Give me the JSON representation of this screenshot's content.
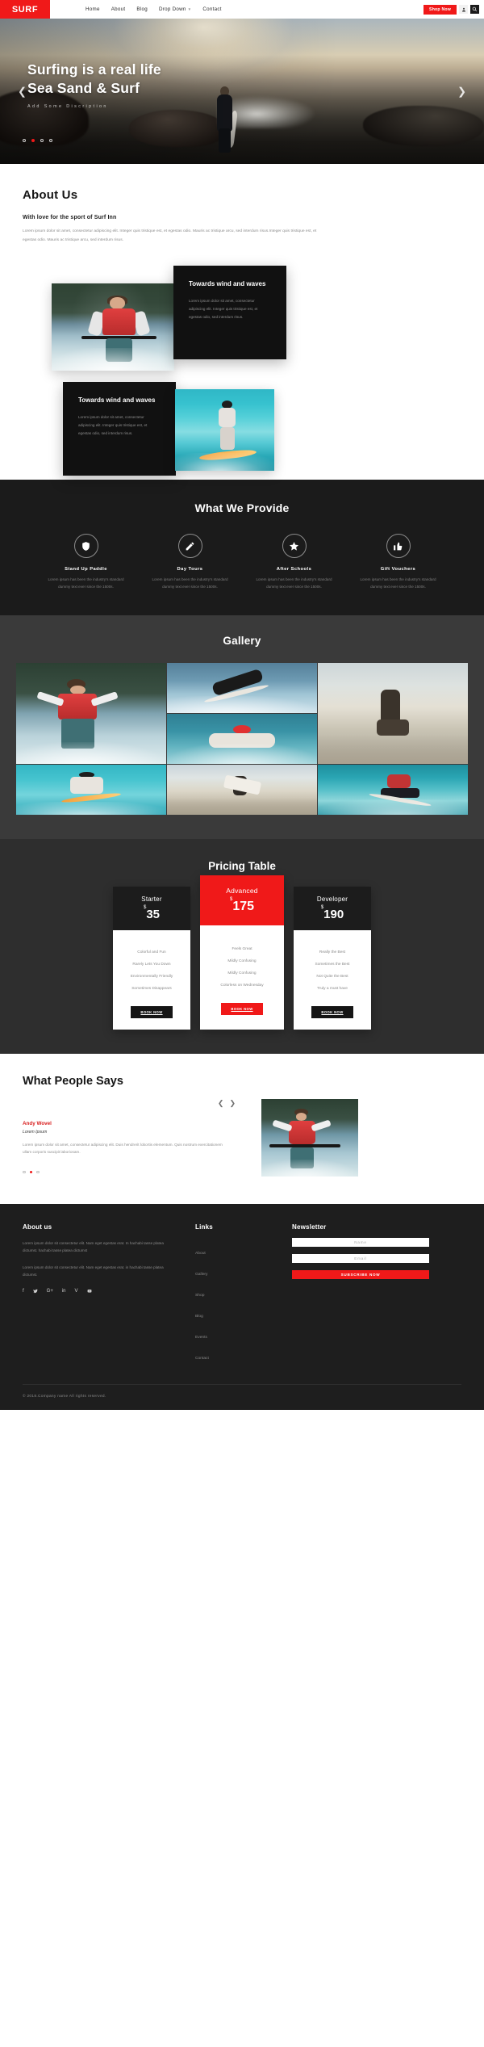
{
  "navbar": {
    "brand": "SURF",
    "links": [
      {
        "label": "Home",
        "has_caret": false
      },
      {
        "label": "About",
        "has_caret": false
      },
      {
        "label": "Blog",
        "has_caret": false
      },
      {
        "label": "Drop Down",
        "has_caret": true
      },
      {
        "label": "Contact",
        "has_caret": false
      }
    ],
    "shop_button": "Shop Now",
    "user_icon": "user-icon",
    "search_icon": "search-icon"
  },
  "hero": {
    "title_line1": "Surfing is a real life",
    "title_line2": "Sea Sand & Surf",
    "subtitle": "Add Some Discription",
    "prev_icon": "chevron-left-icon",
    "next_icon": "chevron-right-icon",
    "dots": [
      false,
      true,
      false,
      false
    ],
    "accent": "#f01919"
  },
  "about": {
    "heading": "About Us",
    "subheading": "With love for the sport of Surf Inn",
    "paragraph": "Lorem ipsum dolor sit amet, consectetur adipiscing elit. Integer quis tristique est, et egestas odio. Mauris ac tristique arcu, sed interdum risus.Integer quis tristique est, et egestas odio. Mauris ac tristique arcu, sed interdum risus.",
    "cards": [
      {
        "title": "Towards wind and waves",
        "text": "Lorem ipsum dolor sit amet, consectetur adipiscing elit. Integer quis tristique est, et egestas odio, sed interdum risus."
      },
      {
        "title": "Towards wind and waves",
        "text": "Lorem ipsum dolor sit amet, consectetur adipiscing elit. Integer quis tristique est, et egestas odio, sed interdum risus."
      }
    ]
  },
  "provide": {
    "heading": "What We Provide",
    "features": [
      {
        "icon": "shield-icon",
        "title": "Stand Up Paddle",
        "text": "Lorem ipsum has been the industry's standard dummy text ever since the 1500s."
      },
      {
        "icon": "pencil-icon",
        "title": "Day Tours",
        "text": "Lorem ipsum has been the industry's standard dummy text ever since the 1500s."
      },
      {
        "icon": "star-icon",
        "title": "After Schools",
        "text": "Lorem ipsum has been the industry's standard dummy text ever since the 1500s."
      },
      {
        "icon": "thumbs-up-icon",
        "title": "Gift Vouchers",
        "text": "Lorem ipsum has been the industry's standard dummy text ever since the 1500s."
      }
    ]
  },
  "gallery": {
    "heading": "Gallery",
    "items": [
      {
        "name": "water-skier-photo"
      },
      {
        "name": "wakeboarder-photo"
      },
      {
        "name": "woman-sitting-beach-photo"
      },
      {
        "name": "red-cap-swimmer-photo"
      },
      {
        "name": "surfer-on-board-photo"
      },
      {
        "name": "woman-walking-beach-photo"
      },
      {
        "name": "surfer-riding-wave-photo"
      }
    ]
  },
  "pricing": {
    "heading": "Pricing Table",
    "currency": "$",
    "plans": [
      {
        "name": "Starter",
        "price": "35",
        "featured": false,
        "features": [
          "Colorful and Fun",
          "Rarely Lets You Down",
          "Environmentally Friendly",
          "Sometimes Disappears"
        ],
        "button": "BOOK NOW"
      },
      {
        "name": "Advanced",
        "price": "175",
        "featured": true,
        "features": [
          "Feels Great",
          "Mildly Confusing",
          "Mildly Confusing",
          "Colorless on Wednesday"
        ],
        "button": "BOOK NOW"
      },
      {
        "name": "Developer",
        "price": "190",
        "featured": false,
        "features": [
          "Really the Best",
          "Sometimes the Best",
          "Not Quite the Best",
          "Truly a must have"
        ],
        "button": "BOOK NOW"
      }
    ]
  },
  "testimonial": {
    "heading": "What People Says",
    "prev_icon": "chevron-left-icon",
    "next_icon": "chevron-right-icon",
    "name": "Andy Wovel",
    "role": "Lorem Ipsum",
    "text": "Lorem ipsum dolor sit amet, consectetur adipiscing elit. Duis hendrerit lobortis elementum. Quis nostrum exercitationem ullam corporis suscipit laboriosam.",
    "dots": [
      false,
      true,
      false
    ],
    "photo": "waterskier-portrait-photo"
  },
  "footer": {
    "about": {
      "heading": "About us",
      "paragraph1": "Lorem ipsum dolor sit consectetur elit. Nam eget egestas erat. In hachabi tasse platea dictumst. hachabi tasse platea dictumst",
      "paragraph2": "Lorem ipsum dolor sit consectetur elit. Nam eget egestas erat. in hachabi tasse platea dictumst.",
      "social": [
        {
          "icon": "facebook-icon",
          "glyph": "f"
        },
        {
          "icon": "twitter-icon",
          "glyph": "✓"
        },
        {
          "icon": "google-plus-icon",
          "glyph": "G+"
        },
        {
          "icon": "linkedin-icon",
          "glyph": "in"
        },
        {
          "icon": "vimeo-icon",
          "glyph": "V"
        },
        {
          "icon": "youtube-icon",
          "glyph": "▶"
        }
      ]
    },
    "links": {
      "heading": "Links",
      "items": [
        "About",
        "Gallery",
        "Shop",
        "Blog",
        "Events",
        "Contact"
      ]
    },
    "newsletter": {
      "heading": "Newsletter",
      "name_placeholder": "Name",
      "email_placeholder": "Email",
      "button": "SUBSCRIBE NOW"
    },
    "copyright": "© 2018.Company name All rights reserved."
  }
}
